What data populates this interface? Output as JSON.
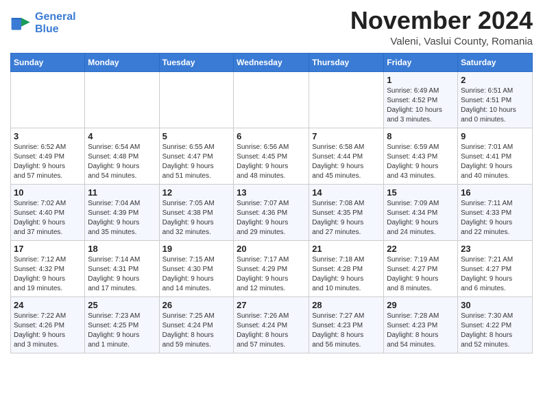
{
  "header": {
    "logo_line1": "General",
    "logo_line2": "Blue",
    "month_title": "November 2024",
    "location": "Valeni, Vaslui County, Romania"
  },
  "weekdays": [
    "Sunday",
    "Monday",
    "Tuesday",
    "Wednesday",
    "Thursday",
    "Friday",
    "Saturday"
  ],
  "weeks": [
    [
      {
        "day": "",
        "detail": ""
      },
      {
        "day": "",
        "detail": ""
      },
      {
        "day": "",
        "detail": ""
      },
      {
        "day": "",
        "detail": ""
      },
      {
        "day": "",
        "detail": ""
      },
      {
        "day": "1",
        "detail": "Sunrise: 6:49 AM\nSunset: 4:52 PM\nDaylight: 10 hours\nand 3 minutes."
      },
      {
        "day": "2",
        "detail": "Sunrise: 6:51 AM\nSunset: 4:51 PM\nDaylight: 10 hours\nand 0 minutes."
      }
    ],
    [
      {
        "day": "3",
        "detail": "Sunrise: 6:52 AM\nSunset: 4:49 PM\nDaylight: 9 hours\nand 57 minutes."
      },
      {
        "day": "4",
        "detail": "Sunrise: 6:54 AM\nSunset: 4:48 PM\nDaylight: 9 hours\nand 54 minutes."
      },
      {
        "day": "5",
        "detail": "Sunrise: 6:55 AM\nSunset: 4:47 PM\nDaylight: 9 hours\nand 51 minutes."
      },
      {
        "day": "6",
        "detail": "Sunrise: 6:56 AM\nSunset: 4:45 PM\nDaylight: 9 hours\nand 48 minutes."
      },
      {
        "day": "7",
        "detail": "Sunrise: 6:58 AM\nSunset: 4:44 PM\nDaylight: 9 hours\nand 45 minutes."
      },
      {
        "day": "8",
        "detail": "Sunrise: 6:59 AM\nSunset: 4:43 PM\nDaylight: 9 hours\nand 43 minutes."
      },
      {
        "day": "9",
        "detail": "Sunrise: 7:01 AM\nSunset: 4:41 PM\nDaylight: 9 hours\nand 40 minutes."
      }
    ],
    [
      {
        "day": "10",
        "detail": "Sunrise: 7:02 AM\nSunset: 4:40 PM\nDaylight: 9 hours\nand 37 minutes."
      },
      {
        "day": "11",
        "detail": "Sunrise: 7:04 AM\nSunset: 4:39 PM\nDaylight: 9 hours\nand 35 minutes."
      },
      {
        "day": "12",
        "detail": "Sunrise: 7:05 AM\nSunset: 4:38 PM\nDaylight: 9 hours\nand 32 minutes."
      },
      {
        "day": "13",
        "detail": "Sunrise: 7:07 AM\nSunset: 4:36 PM\nDaylight: 9 hours\nand 29 minutes."
      },
      {
        "day": "14",
        "detail": "Sunrise: 7:08 AM\nSunset: 4:35 PM\nDaylight: 9 hours\nand 27 minutes."
      },
      {
        "day": "15",
        "detail": "Sunrise: 7:09 AM\nSunset: 4:34 PM\nDaylight: 9 hours\nand 24 minutes."
      },
      {
        "day": "16",
        "detail": "Sunrise: 7:11 AM\nSunset: 4:33 PM\nDaylight: 9 hours\nand 22 minutes."
      }
    ],
    [
      {
        "day": "17",
        "detail": "Sunrise: 7:12 AM\nSunset: 4:32 PM\nDaylight: 9 hours\nand 19 minutes."
      },
      {
        "day": "18",
        "detail": "Sunrise: 7:14 AM\nSunset: 4:31 PM\nDaylight: 9 hours\nand 17 minutes."
      },
      {
        "day": "19",
        "detail": "Sunrise: 7:15 AM\nSunset: 4:30 PM\nDaylight: 9 hours\nand 14 minutes."
      },
      {
        "day": "20",
        "detail": "Sunrise: 7:17 AM\nSunset: 4:29 PM\nDaylight: 9 hours\nand 12 minutes."
      },
      {
        "day": "21",
        "detail": "Sunrise: 7:18 AM\nSunset: 4:28 PM\nDaylight: 9 hours\nand 10 minutes."
      },
      {
        "day": "22",
        "detail": "Sunrise: 7:19 AM\nSunset: 4:27 PM\nDaylight: 9 hours\nand 8 minutes."
      },
      {
        "day": "23",
        "detail": "Sunrise: 7:21 AM\nSunset: 4:27 PM\nDaylight: 9 hours\nand 6 minutes."
      }
    ],
    [
      {
        "day": "24",
        "detail": "Sunrise: 7:22 AM\nSunset: 4:26 PM\nDaylight: 9 hours\nand 3 minutes."
      },
      {
        "day": "25",
        "detail": "Sunrise: 7:23 AM\nSunset: 4:25 PM\nDaylight: 9 hours\nand 1 minute."
      },
      {
        "day": "26",
        "detail": "Sunrise: 7:25 AM\nSunset: 4:24 PM\nDaylight: 8 hours\nand 59 minutes."
      },
      {
        "day": "27",
        "detail": "Sunrise: 7:26 AM\nSunset: 4:24 PM\nDaylight: 8 hours\nand 57 minutes."
      },
      {
        "day": "28",
        "detail": "Sunrise: 7:27 AM\nSunset: 4:23 PM\nDaylight: 8 hours\nand 56 minutes."
      },
      {
        "day": "29",
        "detail": "Sunrise: 7:28 AM\nSunset: 4:23 PM\nDaylight: 8 hours\nand 54 minutes."
      },
      {
        "day": "30",
        "detail": "Sunrise: 7:30 AM\nSunset: 4:22 PM\nDaylight: 8 hours\nand 52 minutes."
      }
    ]
  ]
}
